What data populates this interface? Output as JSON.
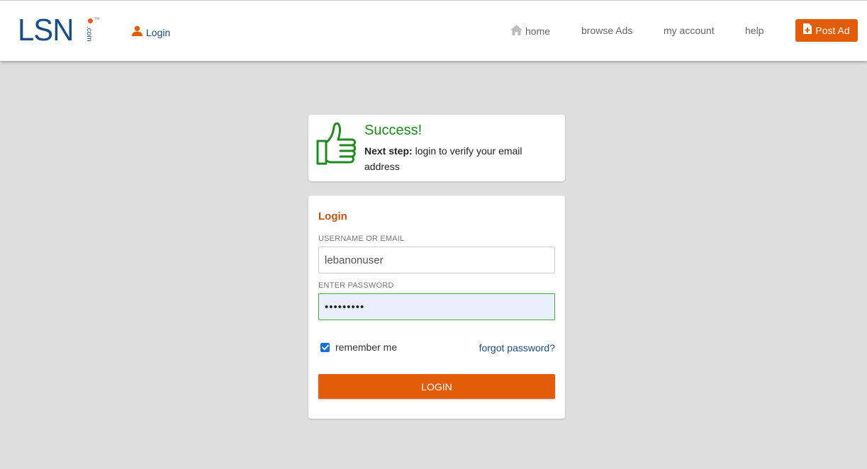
{
  "brand": {
    "logo_text": "LSN",
    "logo_suffix": ".com",
    "logo_tm": "TM",
    "colors": {
      "primary": "#1a4f86",
      "accent": "#e25c0a",
      "success": "#1f8a1f"
    }
  },
  "header": {
    "login_label": "Login",
    "nav": {
      "home": "home",
      "browse": "browse Ads",
      "account": "my account",
      "help": "help"
    },
    "post_ad_label": "Post Ad"
  },
  "success": {
    "title": "Success!",
    "next_step_label": "Next step:",
    "message": "login to verify your email address"
  },
  "login_form": {
    "title": "Login",
    "username_label": "USERNAME OR EMAIL",
    "username_value": "lebanonuser",
    "password_label": "ENTER PASSWORD",
    "password_value": "•••••••••",
    "remember_label": "remember me",
    "remember_checked": true,
    "forgot_label": "forgot password?",
    "submit_label": "LOGIN"
  },
  "icons": {
    "user": "user-icon",
    "home": "home-icon",
    "post": "file-plus-icon",
    "thumb": "thumbs-up-icon",
    "check": "check-icon"
  }
}
